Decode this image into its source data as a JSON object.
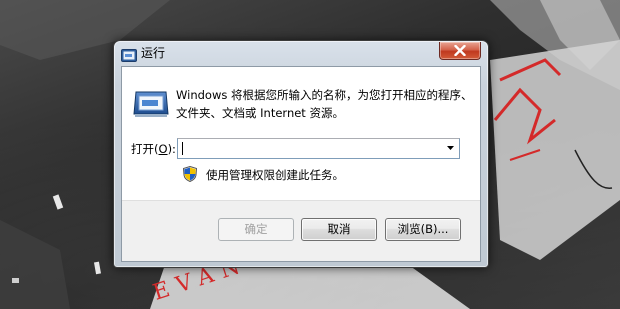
{
  "window": {
    "title": "运行"
  },
  "description": {
    "line1": "Windows 将根据您所输入的名称，为您打开相应的程序、",
    "line2": "文件夹、文档或 Internet 资源。"
  },
  "open_field": {
    "label_prefix": "打开(",
    "label_hotkey": "O",
    "label_suffix": "):",
    "value": ""
  },
  "admin_note": "使用管理权限创建此任务。",
  "buttons": {
    "ok": "确定",
    "cancel": "取消",
    "browse": "浏览(B)..."
  },
  "colors": {
    "close_button": "#c0391f",
    "wallpaper_accent": "#d42a2a"
  },
  "icons": {
    "title": "run-icon",
    "main": "run-icon",
    "shield": "uac-shield-icon",
    "close": "close-icon",
    "dropdown": "chevron-down-icon"
  },
  "wallpaper_text": "EVAN"
}
